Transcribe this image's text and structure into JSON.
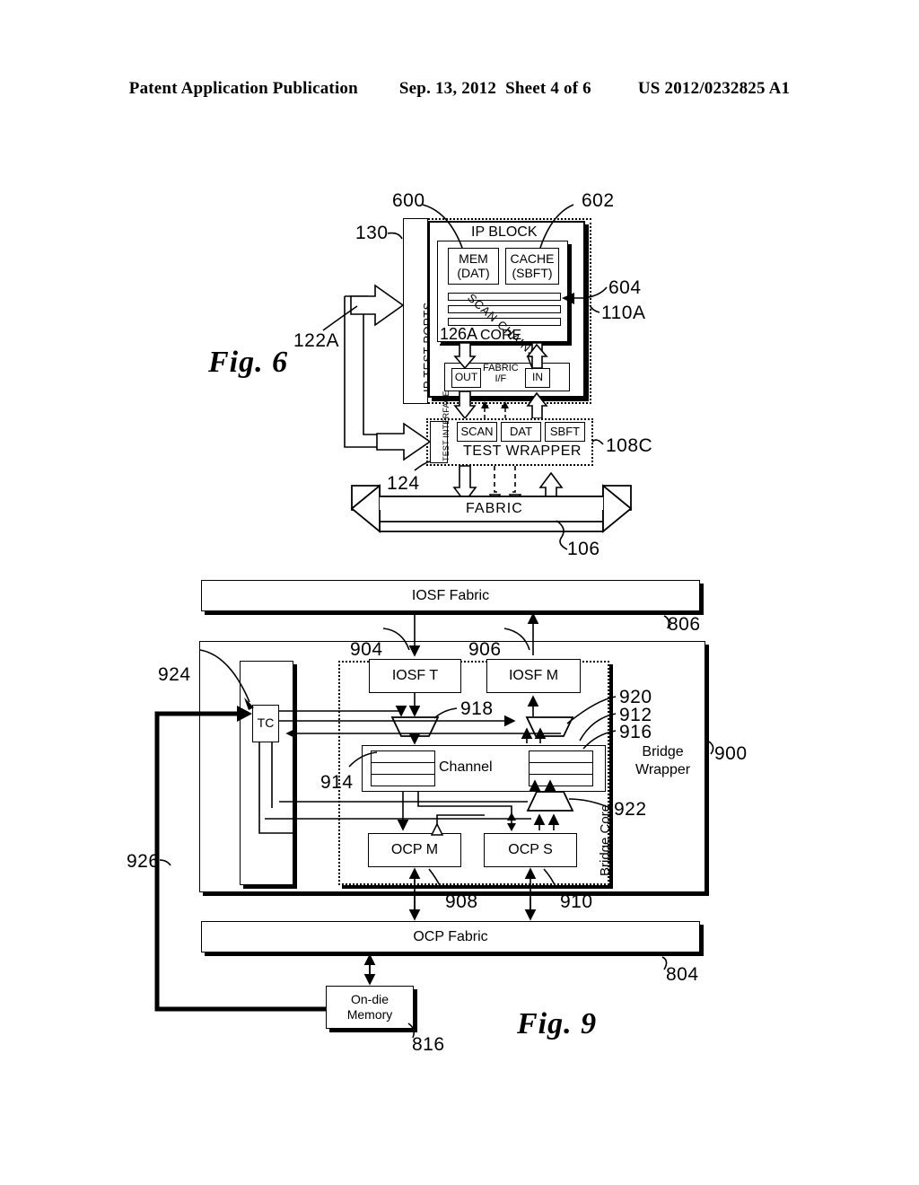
{
  "header": {
    "publication": "Patent Application Publication",
    "date": "Sep. 13, 2012",
    "sheet": "Sheet 4 of 6",
    "docnum": "US 2012/0232825 A1"
  },
  "fig6": {
    "label": "Fig. 6",
    "blocks": {
      "ip_block": "IP BLOCK",
      "ip_test_ports": "IP TEST PORTS",
      "mem": "MEM\n(DAT)",
      "mem_line1": "MEM",
      "mem_line2": "(DAT)",
      "cache_line1": "CACHE",
      "cache_line2": "(SBFT)",
      "scan_chains": "SCAN CHAINS",
      "core": "CORE",
      "fabric_if_line1": "FABRIC",
      "fabric_if_line2": "I/F",
      "out": "OUT",
      "in": "IN",
      "test_interface": "TEST INTERFACE",
      "scan": "SCAN",
      "dat": "DAT",
      "sbft": "SBFT",
      "test_wrapper": "TEST WRAPPER",
      "fabric": "FABRIC"
    },
    "refs": {
      "r130": "130",
      "r600": "600",
      "r602": "602",
      "r604": "604",
      "r110A": "110A",
      "r126A": "126A",
      "r122A": "122A",
      "r124": "124",
      "r108C": "108C",
      "r106": "106"
    }
  },
  "fig9": {
    "label": "Fig. 9",
    "blocks": {
      "iosf_fabric": "IOSF Fabric",
      "iosf_t": "IOSF T",
      "iosf_m": "IOSF M",
      "tc": "TC",
      "channel": "Channel",
      "ocp_m": "OCP M",
      "ocp_s": "OCP S",
      "ocp_fabric": "OCP Fabric",
      "on_die_memory_line1": "On-die",
      "on_die_memory_line2": "Memory",
      "bridge_core": "Bridge Core",
      "bridge_wrapper_line1": "Bridge",
      "bridge_wrapper_line2": "Wrapper"
    },
    "refs": {
      "r806": "806",
      "r804": "804",
      "r816": "816",
      "r900": "900",
      "r904": "904",
      "r906": "906",
      "r908": "908",
      "r910": "910",
      "r912": "912",
      "r914": "914",
      "r916": "916",
      "r918": "918",
      "r920": "920",
      "r922": "922",
      "r924": "924",
      "r926": "926"
    }
  }
}
